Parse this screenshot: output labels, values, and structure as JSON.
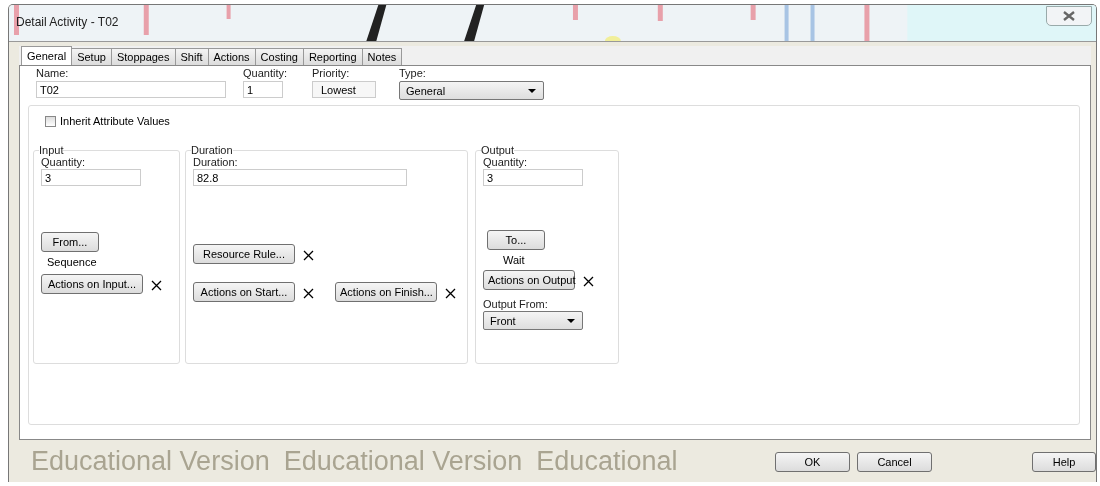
{
  "window": {
    "title": "Detail Activity - T02"
  },
  "tabs": [
    {
      "label": "General",
      "selected": true
    },
    {
      "label": "Setup",
      "selected": false
    },
    {
      "label": "Stoppages",
      "selected": false
    },
    {
      "label": "Shift",
      "selected": false
    },
    {
      "label": "Actions",
      "selected": false
    },
    {
      "label": "Costing",
      "selected": false
    },
    {
      "label": "Reporting",
      "selected": false
    },
    {
      "label": "Notes",
      "selected": false
    }
  ],
  "fields": {
    "name": {
      "label": "Name:",
      "value": "T02"
    },
    "quantity": {
      "label": "Quantity:",
      "value": "1"
    },
    "priority": {
      "label": "Priority:",
      "value": "Lowest"
    },
    "type": {
      "label": "Type:",
      "value": "General"
    }
  },
  "inherit": {
    "label": "Inherit Attribute Values",
    "checked": false
  },
  "input": {
    "title": "Input",
    "quantity_label": "Quantity:",
    "quantity": "3",
    "from_button": "From...",
    "from_value": "Sequence",
    "actions_button": "Actions on Input..."
  },
  "duration": {
    "title": "Duration",
    "duration_label": "Duration:",
    "duration": "82.8",
    "resource_button": "Resource Rule...",
    "start_button": "Actions on Start...",
    "finish_button": "Actions on Finish..."
  },
  "output": {
    "title": "Output",
    "quantity_label": "Quantity:",
    "quantity": "3",
    "to_button": "To...",
    "to_value": "Wait",
    "actions_button": "Actions on Output",
    "from_label": "Output From:",
    "from_value": "Front"
  },
  "watermark": [
    "Educational Version",
    "Educational Version",
    "Educational"
  ],
  "buttons": [
    "OK",
    "Cancel",
    "Help"
  ]
}
